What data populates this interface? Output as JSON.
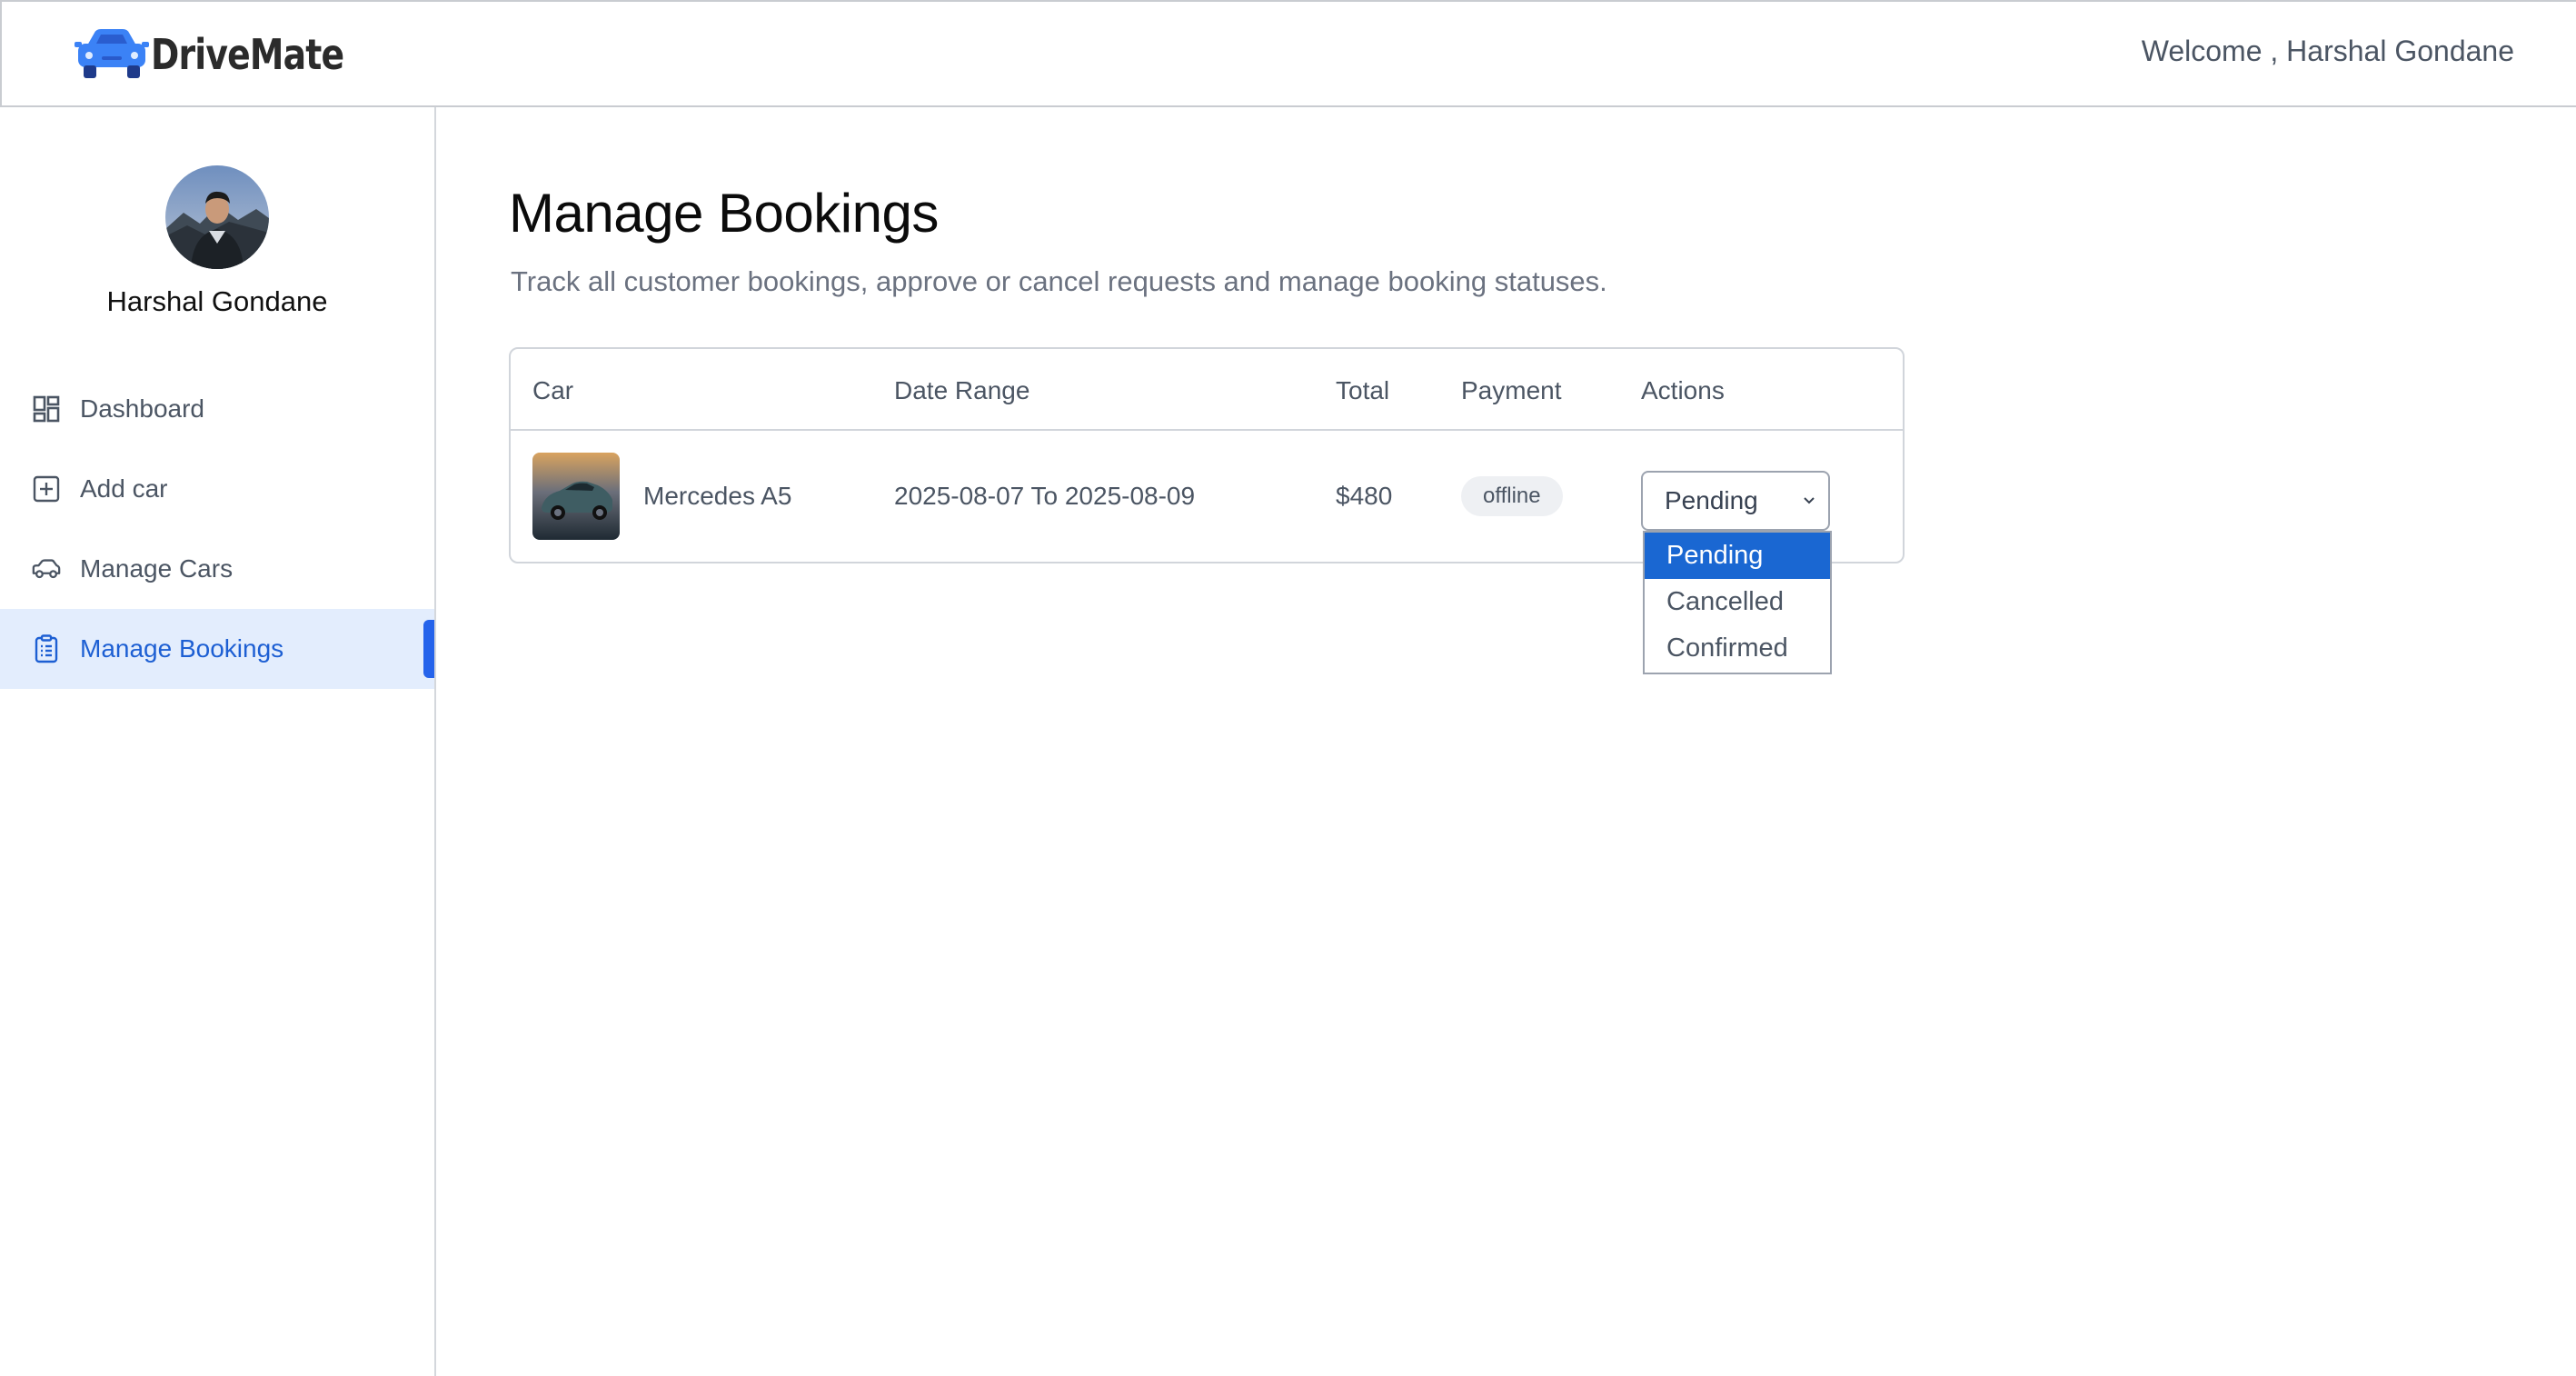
{
  "header": {
    "brand": "DriveMate",
    "welcome": "Welcome , Harshal Gondane"
  },
  "sidebar": {
    "profile_name": "Harshal Gondane",
    "items": [
      {
        "label": "Dashboard",
        "icon": "dashboard-icon"
      },
      {
        "label": "Add car",
        "icon": "add-square-icon"
      },
      {
        "label": "Manage Cars",
        "icon": "car-icon"
      },
      {
        "label": "Manage Bookings",
        "icon": "clipboard-list-icon",
        "active": true
      }
    ]
  },
  "main": {
    "title": "Manage Bookings",
    "subtitle": "Track all customer bookings, approve or cancel requests and manage booking statuses.",
    "table": {
      "columns": [
        "Car",
        "Date Range",
        "Total",
        "Payment",
        "Actions"
      ],
      "rows": [
        {
          "car": "Mercedes A5",
          "date_range": "2025-08-07 To 2025-08-09",
          "total": "$480",
          "payment": "offline",
          "status": "Pending"
        }
      ]
    },
    "status_options": [
      "Pending",
      "Cancelled",
      "Confirmed"
    ]
  },
  "colors": {
    "accent": "#2563eb",
    "active_bg": "#e3edfd",
    "selected_option": "#1a67d2",
    "logo": "#3b82f6"
  }
}
